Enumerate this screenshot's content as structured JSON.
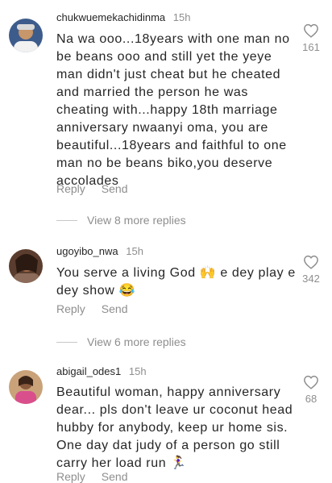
{
  "comments": [
    {
      "username": "chukwuemekachidinma",
      "time": "15h",
      "text": "Na wa ooo...18years with one man no be beans ooo and still yet the yeye man didn't just cheat but he cheated and married the person he was cheating with...happy 18th marriage anniversary nwaanyi oma, you are beautiful...18years and faithful to one man no be beans biko,you deserve accolades",
      "likes": "161",
      "reply_label": "Reply",
      "send_label": "Send",
      "view_replies": "View 8 more replies"
    },
    {
      "username": "ugoyibo_nwa",
      "time": "15h",
      "text_before": "You serve a living God ",
      "emoji1": "🙌",
      "text_middle": " e dey play e dey show ",
      "emoji2": "😂",
      "likes": "342",
      "reply_label": "Reply",
      "send_label": "Send",
      "view_replies": "View 6 more replies"
    },
    {
      "username": "abigail_odes1",
      "time": "15h",
      "text_before": "Beautiful woman, happy anniversary dear... pls don't leave ur coconut head hubby for anybody, keep ur home sis. One day dat judy of a person go still carry her load run ",
      "emoji1": "🏃‍♀️",
      "likes": "68",
      "reply_label": "Reply",
      "send_label": "Send"
    }
  ],
  "icons": {
    "like": "heart-outline-icon"
  },
  "colors": {
    "text": "#262626",
    "muted": "#8e8e8e"
  }
}
